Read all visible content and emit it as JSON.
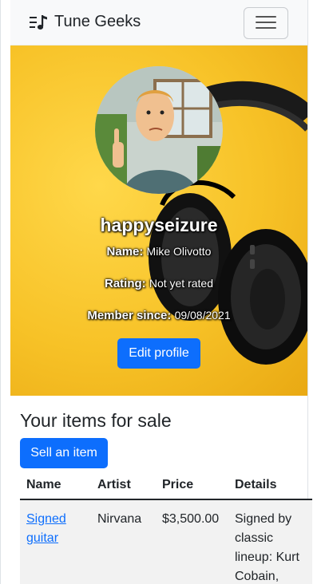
{
  "app": {
    "brand": "Tune Geeks"
  },
  "icons": {
    "brand": "music-list-icon",
    "menu": "hamburger-menu-icon"
  },
  "profile": {
    "username": "happyseizure",
    "name_label": "Name:",
    "name_value": "Mike Olivotto",
    "rating_label": "Rating:",
    "rating_value": "Not yet rated",
    "member_label": "Member since:",
    "member_value": "09/08/2021",
    "edit_button": "Edit profile"
  },
  "items": {
    "title": "Your items for sale",
    "sell_button": "Sell an item",
    "columns": [
      "Name",
      "Artist",
      "Price",
      "Details"
    ],
    "rows": [
      {
        "name": "Signed guitar",
        "artist": "Nirvana",
        "price": "$3,500.00",
        "details": "Signed by classic lineup: Kurt Cobain,"
      }
    ]
  },
  "colors": {
    "primary": "#0d6efd",
    "hero_yellow": "#f7c227",
    "navbar_bg": "#f8f9fa"
  }
}
